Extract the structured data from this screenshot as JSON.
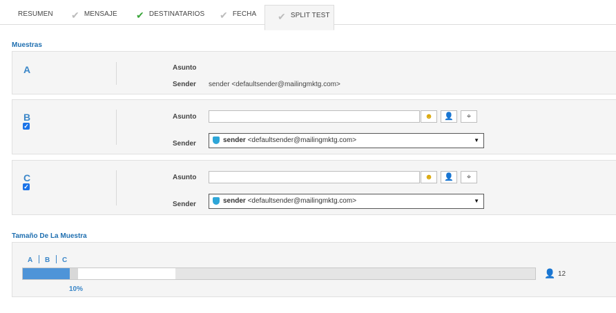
{
  "tabs": [
    {
      "label": "RESUMEN",
      "check": "none"
    },
    {
      "label": "MENSAJE",
      "check": "gray"
    },
    {
      "label": "DESTINATARIOS",
      "check": "green"
    },
    {
      "label": "FECHA",
      "check": "gray"
    },
    {
      "label": "SPLIT TEST",
      "check": "gray",
      "active": true
    }
  ],
  "samples_title": "Muestras",
  "samples": {
    "a": {
      "letter": "A",
      "subject_label": "Asunto",
      "sender_label": "Sender",
      "sender_value": "sender <defaultsender@mailingmktg.com>"
    },
    "b": {
      "letter": "B",
      "checked": true,
      "subject_label": "Asunto",
      "subject_value": "",
      "sender_label": "Sender",
      "sender_name": "sender",
      "sender_email": "<defaultsender@mailingmktg.com>"
    },
    "c": {
      "letter": "C",
      "checked": true,
      "subject_label": "Asunto",
      "subject_value": "",
      "sender_label": "Sender",
      "sender_name": "sender",
      "sender_email": "<defaultsender@mailingmktg.com>"
    }
  },
  "sample_size": {
    "title": "Tamaño De La Muestra",
    "labels": [
      "A",
      "B",
      "C"
    ],
    "percent_label": "10%",
    "percent": 10,
    "count": "12"
  },
  "icons": {
    "check": "check-icon",
    "emoji": "emoji-icon",
    "person": "person-icon",
    "tag": "tag-cursor-icon",
    "shield": "shield-icon"
  },
  "colors": {
    "accent": "#1f6fb0",
    "check_green": "#3aa53a",
    "bar_fill": "#4e94d8"
  }
}
